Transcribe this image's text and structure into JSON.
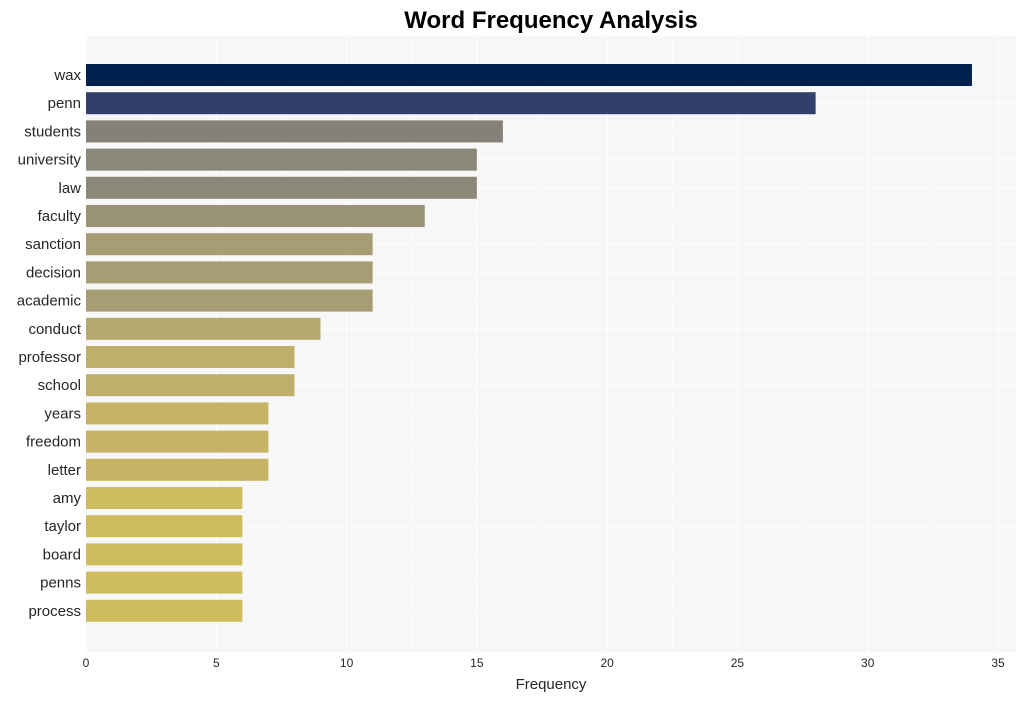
{
  "chart_data": {
    "type": "bar",
    "orientation": "horizontal",
    "title": "Word Frequency Analysis",
    "xlabel": "Frequency",
    "ylabel": "",
    "xlim": [
      0,
      35.7
    ],
    "xticks": [
      0,
      5,
      10,
      15,
      20,
      25,
      30,
      35
    ],
    "grid": true,
    "categories": [
      "wax",
      "penn",
      "students",
      "university",
      "law",
      "faculty",
      "sanction",
      "decision",
      "academic",
      "conduct",
      "professor",
      "school",
      "years",
      "freedom",
      "letter",
      "amy",
      "taylor",
      "board",
      "penns",
      "process"
    ],
    "values": [
      34,
      28,
      16,
      15,
      15,
      13,
      11,
      11,
      11,
      9,
      8,
      8,
      7,
      7,
      7,
      6,
      6,
      6,
      6,
      6
    ],
    "colors": [
      "#00204e",
      "#31406b",
      "#858178",
      "#8b8878",
      "#8b8878",
      "#999275",
      "#a69d75",
      "#a69d75",
      "#a69d75",
      "#b6a970",
      "#beaf6a",
      "#beaf6a",
      "#c6b464",
      "#c6b464",
      "#c6b464",
      "#cfbc5f",
      "#cfbc5f",
      "#cfbc5f",
      "#cfbc5f",
      "#cfbc5f"
    ],
    "background": "#f7f7f7",
    "gridline_color": "#ffffff"
  }
}
